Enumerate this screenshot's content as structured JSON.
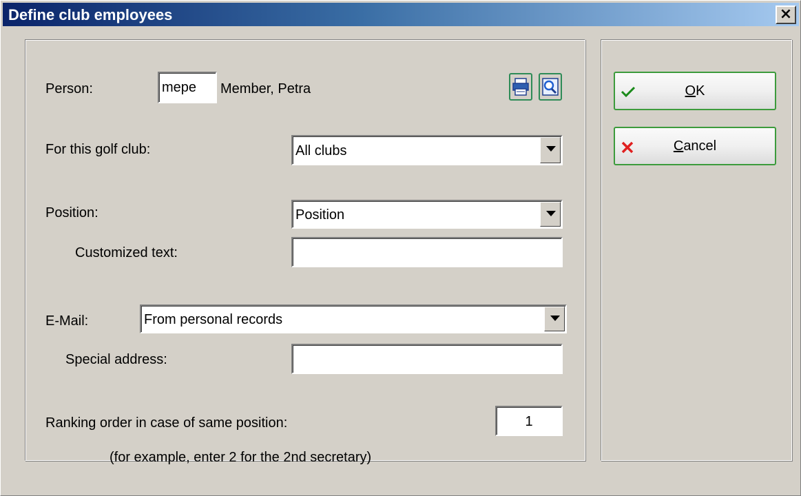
{
  "window": {
    "title": "Define club employees",
    "close_label": "×"
  },
  "person": {
    "label": "Person:",
    "code": "mepe",
    "name": "Member, Petra"
  },
  "golf_club": {
    "label": "For this golf club:",
    "value": "All clubs"
  },
  "position": {
    "label": "Position:",
    "value": "Position",
    "custom_label": "Customized text:",
    "custom_value": ""
  },
  "email": {
    "label": "E-Mail:",
    "value": "From personal records",
    "special_label": "Special address:",
    "special_value": ""
  },
  "ranking": {
    "label": "Ranking order in case of same position:",
    "value": "1",
    "hint": "(for example, enter 2 for the 2nd secretary)"
  },
  "buttons": {
    "ok_mnemonic": "O",
    "ok_rest": "K",
    "cancel_mnemonic": "C",
    "cancel_rest": "ancel"
  },
  "icons": {
    "print": "printer-icon",
    "search": "magnifier-icon",
    "ok": "checkmark-icon",
    "cancel": "x-mark-icon"
  },
  "colors": {
    "title_start": "#0a246a",
    "title_end": "#a6caf0",
    "button_border": "#3c9b3c",
    "icon_frame": "#2e8b57",
    "cancel_x": "#e02020",
    "ok_check": "#1a8a1a"
  }
}
